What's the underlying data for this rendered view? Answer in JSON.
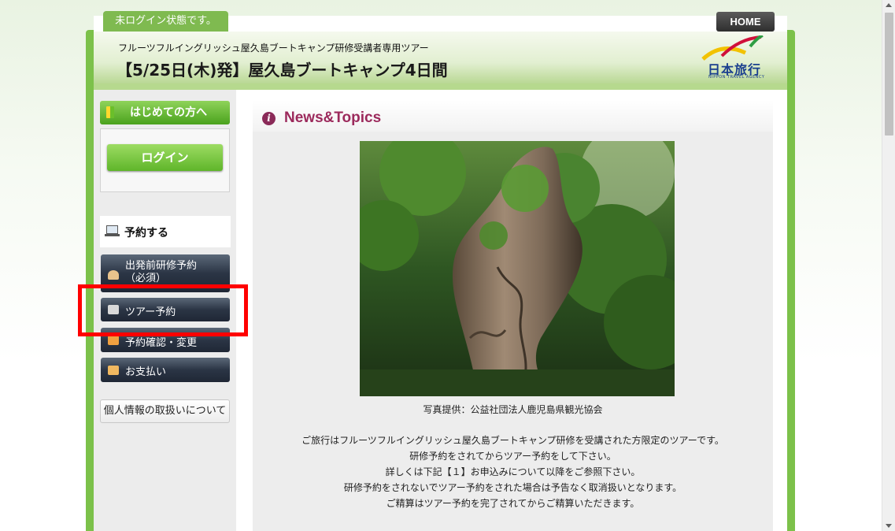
{
  "top": {
    "status": "未ログイン状態です。",
    "home_label": "HOME"
  },
  "header": {
    "subtitle": "フルーツフルイングリッシュ屋久島ブートキャンプ研修受講者専用ツアー",
    "title": "【5/25日(木)発】屋久島ブートキャンプ4日間",
    "logo_text": "日本旅行",
    "logo_subtext": "NIPPON TRAVEL AGENCY"
  },
  "sidebar": {
    "first_time_label": "はじめての方へ",
    "login_label": "ログイン",
    "reserve_heading": "予約する",
    "items": [
      {
        "label_line1": "出発前研修予約",
        "label_line2": "（必須）"
      },
      {
        "label": "ツアー予約"
      },
      {
        "label": "予約確認・変更"
      },
      {
        "label": "お支払い"
      }
    ],
    "privacy_label": "個人情報の取扱いについて"
  },
  "main": {
    "section_title": "News&Topics",
    "info_glyph": "i",
    "photo_caption": "写真提供：公益社団法人鹿児島県観光協会",
    "lines": [
      "ご旅行はフルーツフルイングリッシュ屋久島ブートキャンプ研修を受講された方限定のツアーです。",
      "研修予約をされてからツアー予約をして下さい。",
      "詳しくは下記【１】お申込みについて以降をご参照下さい。",
      "研修予約をされないでツアー予約をされた場合は予告なく取消扱いとなります。",
      "ご精算はツアー予約を完了されてからご精算いただきます。"
    ]
  },
  "colors": {
    "brand_green": "#7cc14a",
    "nav_dark": "#2b3545",
    "title_accent": "#9c2a5c",
    "highlight": "#ff0000"
  }
}
